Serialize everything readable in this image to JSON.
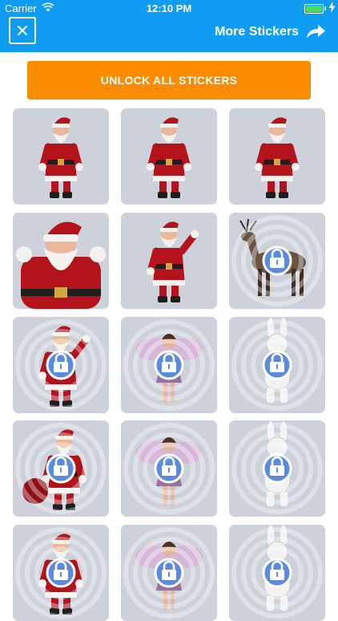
{
  "status_bar": {
    "carrier": "Carrier",
    "time": "12:10 PM",
    "battery_color": "#4cd964"
  },
  "header": {
    "background_color": "#0f9cf3",
    "close_icon": "close-icon",
    "more_stickers_label": "More Stickers",
    "more_stickers_icon": "share-arrow-icon"
  },
  "unlock_button": {
    "label": "UNLOCK ALL STICKERS",
    "color": "#fb8c00"
  },
  "stickers": [
    {
      "subject": "santa-standing",
      "locked": false
    },
    {
      "subject": "santa-standing",
      "locked": false
    },
    {
      "subject": "santa-standing",
      "locked": false
    },
    {
      "subject": "santa-waving-closeup",
      "locked": false
    },
    {
      "subject": "santa-saluting",
      "locked": false
    },
    {
      "subject": "reindeer",
      "locked": true
    },
    {
      "subject": "santa-waving",
      "locked": true
    },
    {
      "subject": "fairy",
      "locked": true
    },
    {
      "subject": "easter-bunny",
      "locked": true
    },
    {
      "subject": "santa-with-sack",
      "locked": true
    },
    {
      "subject": "fairy-with-wand",
      "locked": true
    },
    {
      "subject": "easter-bunny-waving",
      "locked": true
    },
    {
      "subject": "santa-sitting",
      "locked": true
    },
    {
      "subject": "fairy-closeup",
      "locked": true
    },
    {
      "subject": "easter-bunny-closeup",
      "locked": true
    }
  ],
  "lock_icon": "lock-icon"
}
